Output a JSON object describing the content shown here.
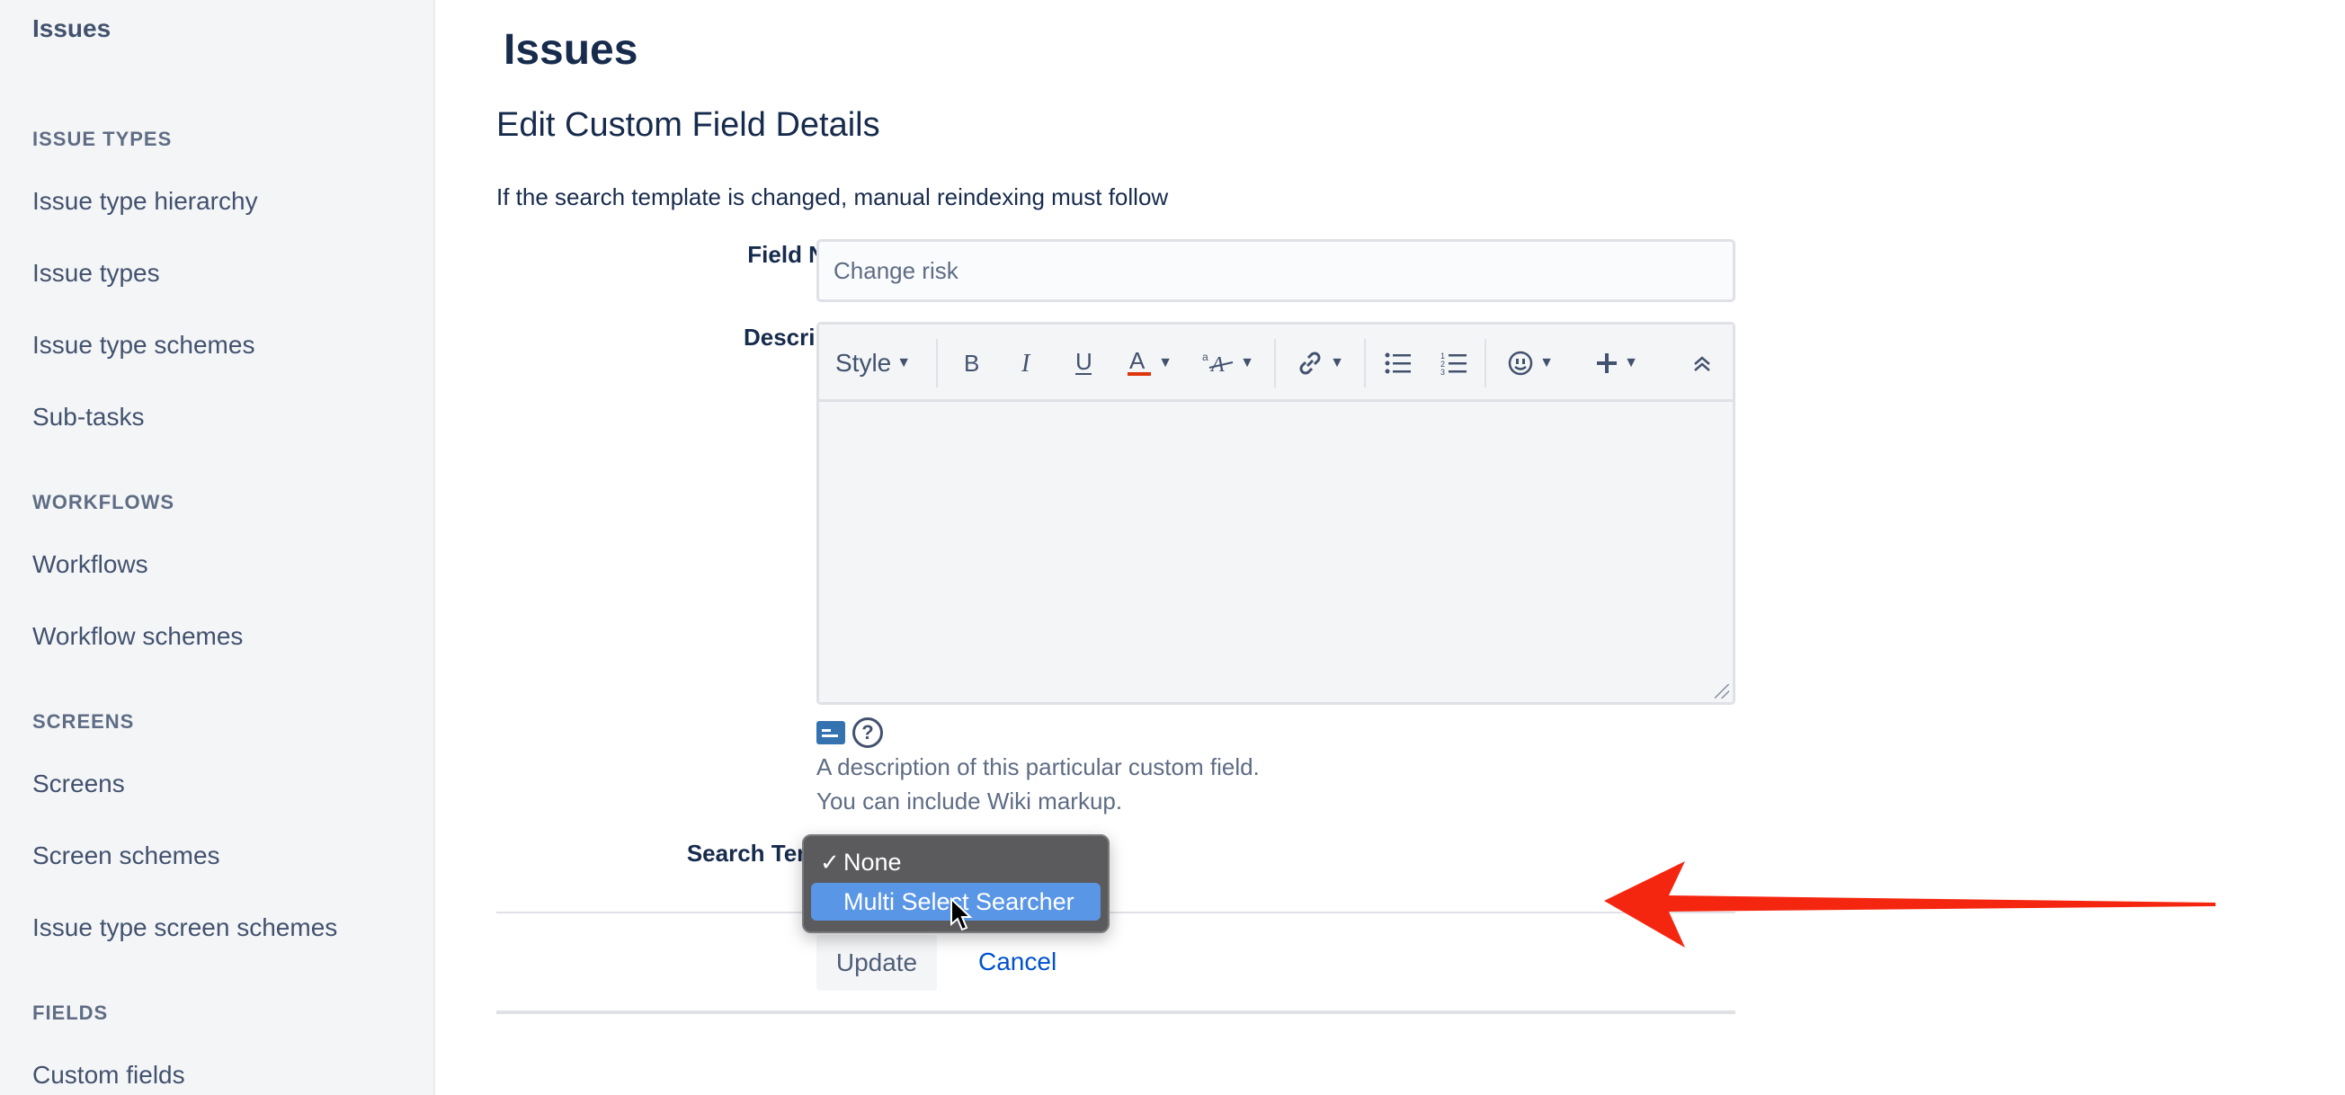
{
  "sidebar": {
    "top_item": "Issues",
    "sections": [
      {
        "heading": "ISSUE TYPES",
        "items": [
          "Issue type hierarchy",
          "Issue types",
          "Issue type schemes",
          "Sub-tasks"
        ]
      },
      {
        "heading": "WORKFLOWS",
        "items": [
          "Workflows",
          "Workflow schemes"
        ]
      },
      {
        "heading": "SCREENS",
        "items": [
          "Screens",
          "Screen schemes",
          "Issue type screen schemes"
        ]
      },
      {
        "heading": "FIELDS",
        "items": [
          "Custom fields"
        ]
      }
    ]
  },
  "main": {
    "page_title": "Issues",
    "section_title": "Edit Custom Field Details",
    "notice": "If the search template is changed, manual reindexing must follow",
    "field_name": {
      "label": "Field Name",
      "value": "Change risk"
    },
    "description": {
      "label": "Description",
      "toolbar": {
        "style_label": "Style"
      },
      "hint_line1": "A description of this particular custom field.",
      "hint_line2": "You can include Wiki markup."
    },
    "search_template": {
      "label": "Search Template",
      "options": [
        {
          "label": "None",
          "checked": true
        },
        {
          "label": "Multi Select Searcher",
          "highlighted": true
        }
      ]
    },
    "buttons": {
      "update": "Update",
      "cancel": "Cancel"
    }
  },
  "colors": {
    "accent_link": "#0052cc",
    "highlight": "#5a96e6",
    "annotation_arrow": "#f5260f",
    "text_color_underline": "#de350b"
  },
  "icons": [
    "bold-icon",
    "italic-icon",
    "underline-icon",
    "text-color-icon",
    "text-effects-icon",
    "link-icon",
    "bullet-list-icon",
    "numbered-list-icon",
    "emoji-icon",
    "insert-plus-icon",
    "collapse-toolbar-icon",
    "wiki-markup-icon",
    "help-icon",
    "check-icon",
    "cursor-icon",
    "red-arrow-annotation"
  ]
}
